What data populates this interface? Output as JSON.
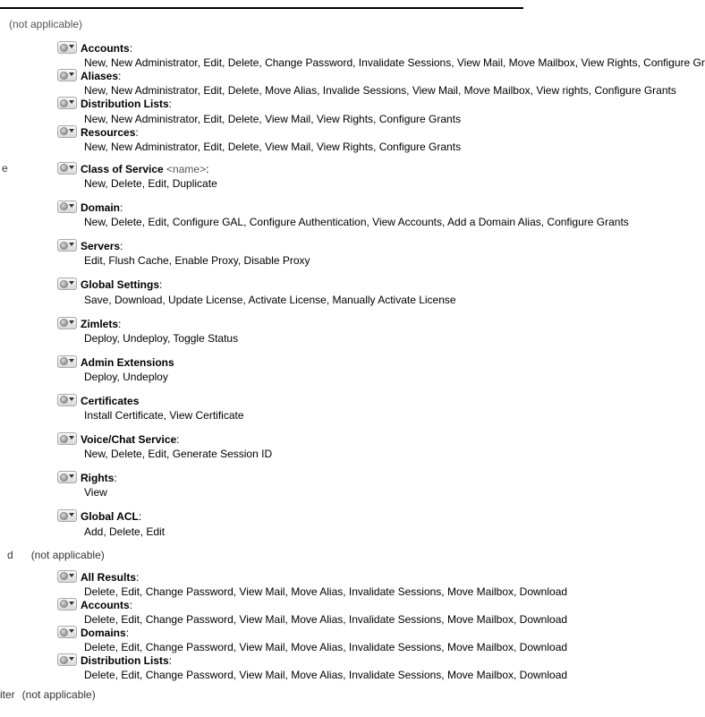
{
  "top_not_applicable": "(not applicable)",
  "side_letter_e": "e",
  "side_letter_d": "d",
  "bottom_frag": "iter",
  "na_text": "(not applicable)",
  "sections": {
    "block1": [
      {
        "heading": "Accounts",
        "colon": ":",
        "actions": "New, New Administrator, Edit, Delete, Change Password, Invalidate Sessions, View Mail, Move Mailbox, View Rights, Configure Gra"
      },
      {
        "heading": "Aliases",
        "colon": ":",
        "actions": "New, New Administrator, Edit, Delete, Move Alias, Invalide Sessions, View Mail, Move Mailbox, View rights, Configure Grants"
      },
      {
        "heading": "Distribution Lists",
        "colon": ":",
        "actions": "New, New Administrator, Edit, Delete, View Mail, View Rights, Configure Grants"
      },
      {
        "heading": "Resources",
        "colon": ":",
        "actions": "New, New Administrator, Edit, Delete, View Mail, View Rights, Configure Grants"
      }
    ],
    "cos": {
      "heading": "Class of Service",
      "suffix": " <name>",
      "colon": ":",
      "actions": "New, Delete, Edit, Duplicate"
    },
    "block2": [
      {
        "heading": "Domain",
        "colon": ":",
        "actions": "New, Delete, Edit, Configure GAL, Configure Authentication, View Accounts, Add a Domain Alias, Configure Grants"
      },
      {
        "heading": "Servers",
        "colon": ":",
        "actions": "Edit, Flush Cache, Enable Proxy, Disable Proxy"
      },
      {
        "heading": "Global Settings",
        "colon": ":",
        "actions": "Save, Download, Update License, Activate License, Manually Activate License"
      },
      {
        "heading": "Zimlets",
        "colon": ":",
        "actions": "Deploy, Undeploy, Toggle Status"
      },
      {
        "heading": "Admin Extensions",
        "colon": "",
        "actions": "Deploy, Undeploy"
      },
      {
        "heading": "Certificates",
        "colon": "",
        "actions": "Install Certificate, View Certificate"
      },
      {
        "heading": "Voice/Chat Service",
        "colon": ":",
        "actions": "New, Delete, Edit, Generate Session ID"
      },
      {
        "heading": "Rights",
        "colon": ":",
        "actions": "View"
      },
      {
        "heading": "Global ACL",
        "colon": ":",
        "actions": "Add, Delete, Edit"
      }
    ],
    "block3": [
      {
        "heading": "All Results",
        "colon": ":",
        "actions": "Delete, Edit, Change Password, View Mail, Move Alias, Invalidate Sessions, Move Mailbox, Download"
      },
      {
        "heading": "Accounts",
        "colon": ":",
        "actions": "Delete, Edit, Change Password, View Mail, Move Alias, Invalidate Sessions, Move Mailbox, Download"
      },
      {
        "heading": "Domains",
        "colon": ":",
        "actions": "Delete, Edit, Change Password, View Mail, Move Alias, Invalidate Sessions, Move Mailbox, Download"
      },
      {
        "heading": "Distribution Lists",
        "colon": ":",
        "actions": "Delete, Edit, Change Password, View Mail, Move Alias, Invalidate Sessions, Move Mailbox, Download"
      }
    ]
  }
}
